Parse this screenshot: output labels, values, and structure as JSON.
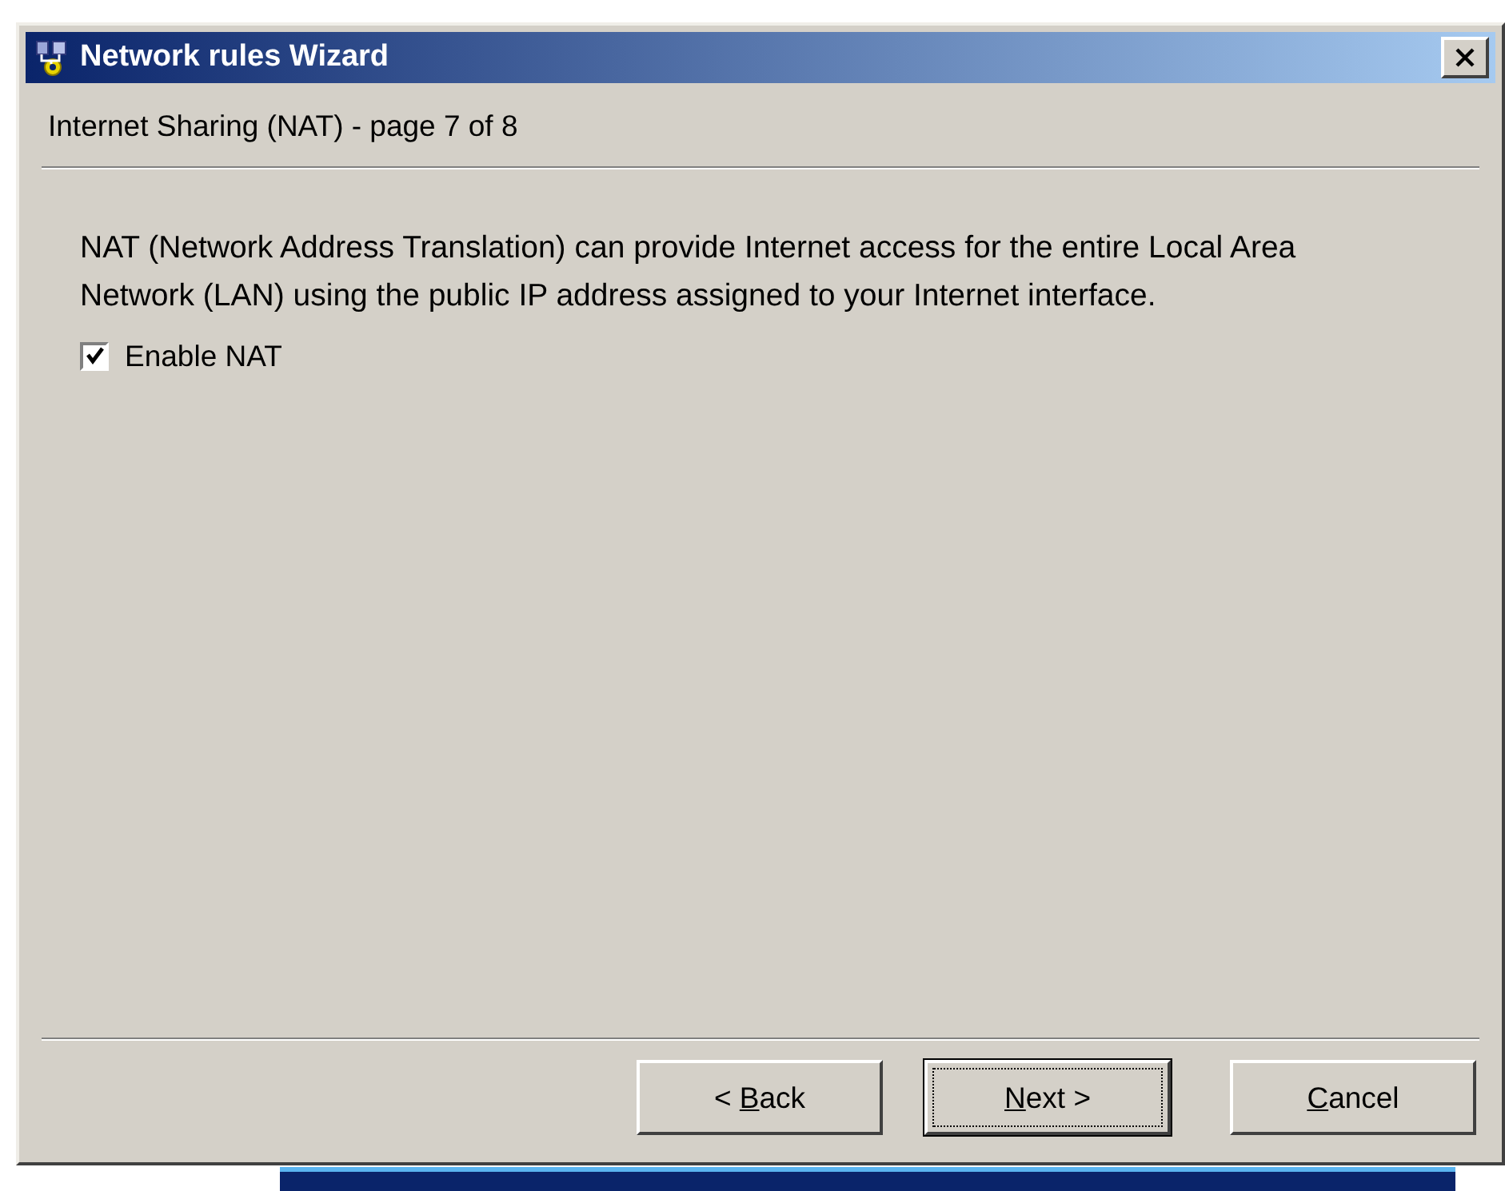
{
  "window": {
    "title": "Network rules Wizard"
  },
  "header": {
    "subtitle": "Internet Sharing (NAT) - page 7 of 8"
  },
  "description": "NAT (Network Address Translation) can provide Internet access for the entire Local Area Network (LAN) using the public IP address assigned to your Internet interface.",
  "options": [
    {
      "label": "Enable NAT",
      "checked": true
    }
  ],
  "buttons": [
    {
      "before": "< ",
      "key": "B",
      "after": "ack",
      "focused": false
    },
    {
      "key": "N",
      "after": "ext >",
      "focused": true
    },
    {
      "key": "C",
      "after": "ancel",
      "focused": false
    }
  ]
}
